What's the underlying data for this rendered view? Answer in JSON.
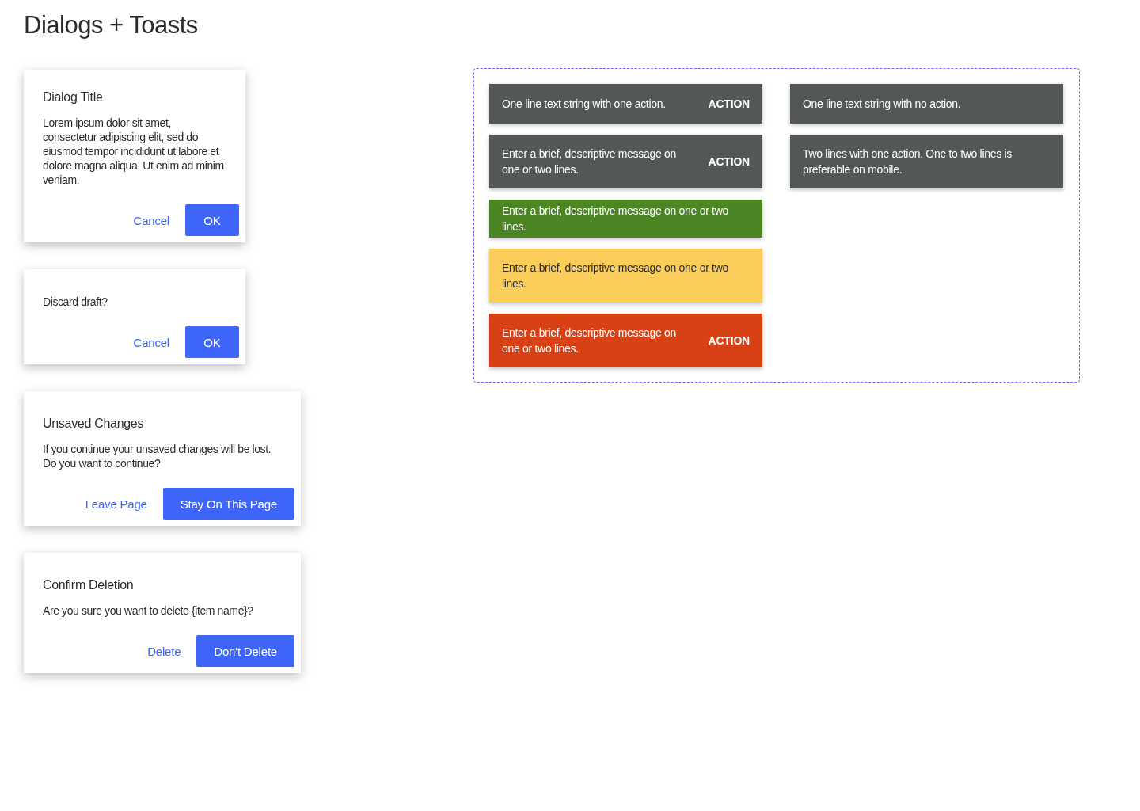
{
  "page_title": "Dialogs + Toasts",
  "dialogs": [
    {
      "kind": "small",
      "title": "Dialog Title",
      "body": "Lorem ipsum dolor sit amet, consectetur adipiscing elit, sed do eiusmod tempor incididunt ut labore et dolore magna aliqua. Ut enim ad minim veniam.",
      "secondary": "Cancel",
      "primary": "OK"
    },
    {
      "kind": "small",
      "body": "Discard draft?",
      "secondary": "Cancel",
      "primary": "OK"
    },
    {
      "kind": "large",
      "title": "Unsaved Changes",
      "body": "If you continue your unsaved changes will be lost. Do you want to continue?",
      "secondary": "Leave Page",
      "primary": "Stay On This Page"
    },
    {
      "kind": "large",
      "title": "Confirm Deletion",
      "body": "Are you sure you want to delete {item name}?",
      "secondary": "Delete",
      "primary": "Don't Delete"
    }
  ],
  "toasts": {
    "left": [
      {
        "kind": "neutral",
        "message": "One line text string with one action.",
        "action": "ACTION"
      },
      {
        "kind": "neutral",
        "message": "Enter a brief, descriptive message on one or two lines.",
        "action": "ACTION"
      },
      {
        "kind": "success",
        "message": "Enter a brief, descriptive message on one or two lines."
      },
      {
        "kind": "warning",
        "message": "Enter a brief, descriptive message on one or two lines."
      },
      {
        "kind": "error",
        "message": "Enter a brief, descriptive message on one or two lines.",
        "action": "ACTION"
      }
    ],
    "right": [
      {
        "kind": "neutral",
        "message": "One line text string with no action."
      },
      {
        "kind": "neutral",
        "message": "Two lines with one action. One to two lines is preferable on mobile."
      }
    ]
  }
}
